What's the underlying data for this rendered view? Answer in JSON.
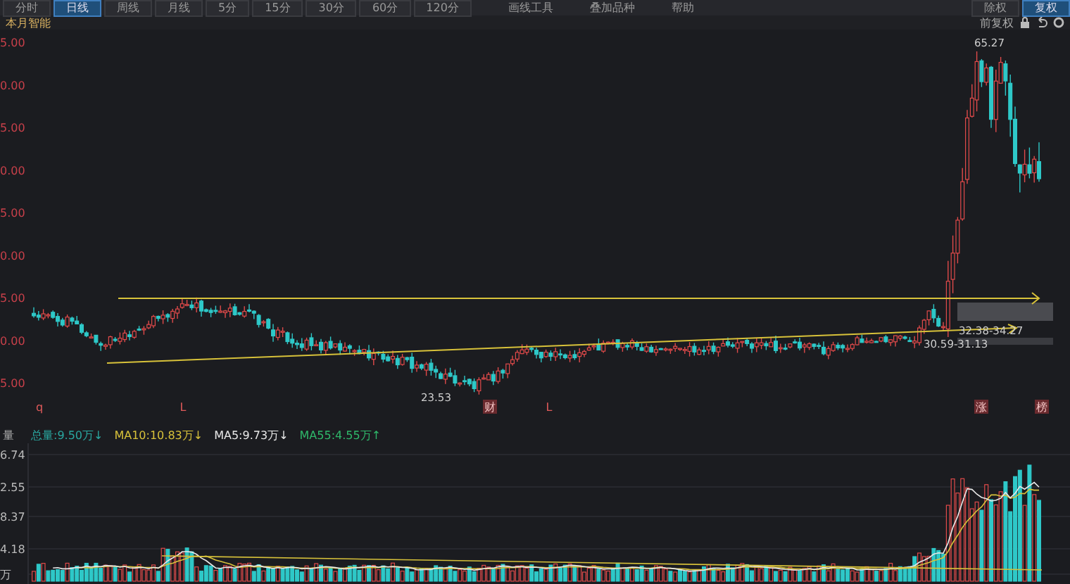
{
  "toolbar": {
    "tabs": [
      {
        "label": "分时",
        "selected": false
      },
      {
        "label": "日线",
        "selected": true
      },
      {
        "label": "周线",
        "selected": false
      },
      {
        "label": "月线",
        "selected": false
      },
      {
        "label": "5分",
        "selected": false
      },
      {
        "label": "15分",
        "selected": false
      },
      {
        "label": "30分",
        "selected": false
      },
      {
        "label": "60分",
        "selected": false
      },
      {
        "label": "120分",
        "selected": false
      }
    ],
    "tools": [
      "画线工具",
      "叠加品种",
      "帮助"
    ],
    "right_tabs": [
      {
        "label": "除权",
        "selected": false
      },
      {
        "label": "复权",
        "selected": true
      }
    ]
  },
  "subbar": {
    "indicator": "本月智能",
    "adjust": "前复权"
  },
  "price_axis": [
    "5.00",
    "0.00",
    "5.00",
    "0.00",
    "5.00",
    "0.00",
    "5.00",
    "0.00",
    "5.00"
  ],
  "price_notes": {
    "high": "65.27",
    "low": "23.53",
    "upper_range": "32.38-34.27",
    "lower_range": "30.59-31.13"
  },
  "markers": [
    {
      "label": "q",
      "boxed": false
    },
    {
      "label": "L",
      "boxed": false
    },
    {
      "label": "财",
      "boxed": true
    },
    {
      "label": "L",
      "boxed": false
    },
    {
      "label": "涨",
      "boxed": true
    },
    {
      "label": "榜",
      "boxed": true
    }
  ],
  "volume": {
    "title": "量",
    "legend": [
      {
        "label": "总量:9.50万",
        "arrow": "↓",
        "color": "#2aa7a0"
      },
      {
        "label": "MA10:10.83万",
        "arrow": "↓",
        "color": "#d8c23a"
      },
      {
        "label": "MA5:9.73万",
        "arrow": "↓",
        "color": "#e8e8e8"
      },
      {
        "label": "MA55:4.55万",
        "arrow": "↑",
        "color": "#2fb86a"
      }
    ],
    "axis": [
      "6.74",
      "2.55",
      "8.37",
      "4.18",
      "万"
    ]
  }
}
